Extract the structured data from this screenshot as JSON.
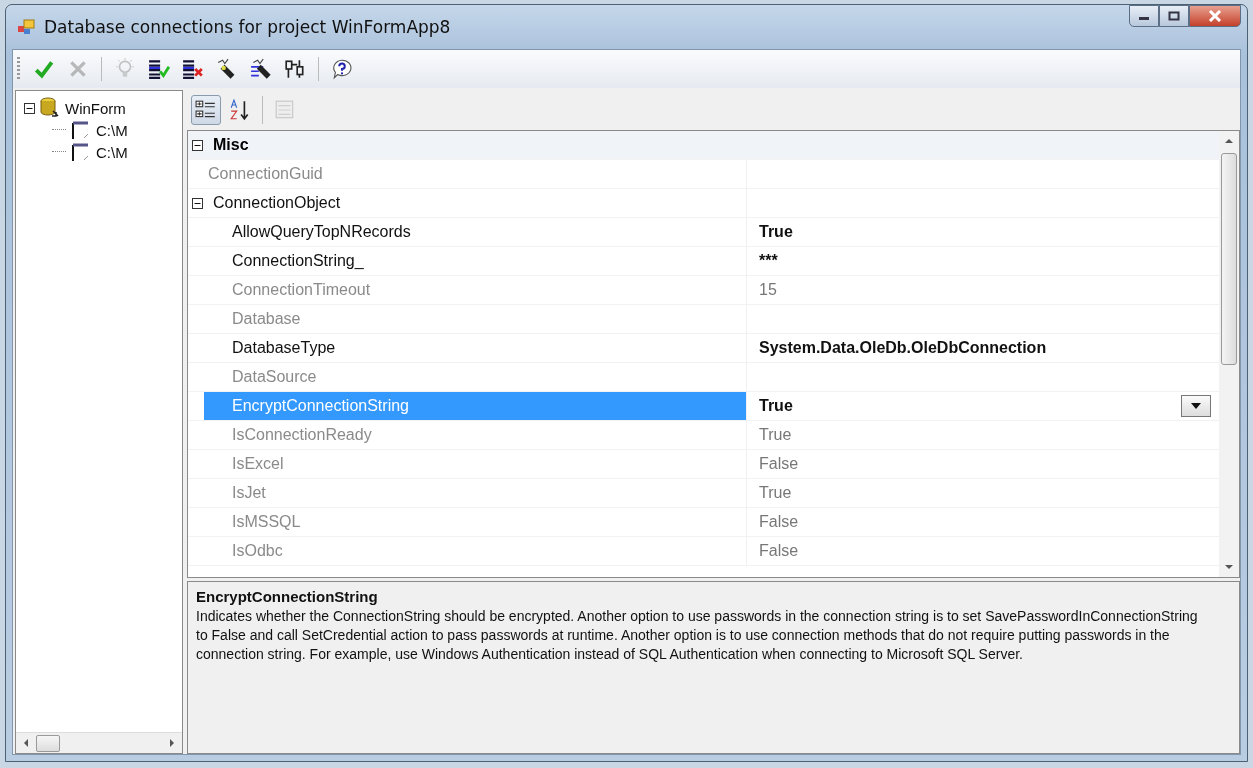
{
  "window": {
    "title": "Database connections for project WinFormApp8"
  },
  "toolbar": [
    {
      "kind": "check",
      "disabled": false
    },
    {
      "kind": "cross",
      "disabled": true
    },
    {
      "kind": "separator"
    },
    {
      "kind": "bulb",
      "disabled": true
    },
    {
      "kind": "list-check",
      "disabled": false
    },
    {
      "kind": "list-cross",
      "disabled": false
    },
    {
      "kind": "plug",
      "disabled": false
    },
    {
      "kind": "list-plug",
      "disabled": false
    },
    {
      "kind": "network",
      "disabled": false
    },
    {
      "kind": "separator"
    },
    {
      "kind": "help",
      "disabled": false
    }
  ],
  "tree": [
    {
      "label": "WinForm",
      "kind": "database",
      "expanded": true,
      "children": [
        {
          "label": "C:\\M",
          "kind": "connection"
        },
        {
          "label": "C:\\M",
          "kind": "connection"
        }
      ]
    }
  ],
  "grid_toolbar": [
    {
      "kind": "categorized",
      "selected": true,
      "disabled": false
    },
    {
      "kind": "alphabetical",
      "selected": false,
      "disabled": false
    },
    {
      "kind": "separator"
    },
    {
      "kind": "property-pages",
      "selected": false,
      "disabled": true
    }
  ],
  "grid": [
    {
      "kind": "category",
      "name": "Misc",
      "expanded": true,
      "children": [
        {
          "kind": "property",
          "name": "ConnectionGuid",
          "readonly": true,
          "selected": false
        },
        {
          "kind": "property",
          "name": "ConnectionObject",
          "readonly": false,
          "selected": false,
          "expanded": true,
          "children": [
            {
              "kind": "property",
              "name": "AllowQueryTopNRecords",
              "value": "True",
              "readonly": false,
              "modified": true,
              "selected": false
            },
            {
              "kind": "property",
              "name": "ConnectionString_",
              "value": "***",
              "readonly": false,
              "modified": true,
              "selected": false
            },
            {
              "kind": "property",
              "name": "ConnectionTimeout",
              "value": "15",
              "readonly": true,
              "modified": false,
              "selected": false
            },
            {
              "kind": "property",
              "name": "Database",
              "readonly": true,
              "selected": false
            },
            {
              "kind": "property",
              "name": "DatabaseType",
              "value": "System.Data.OleDb.OleDbConnection",
              "readonly": false,
              "modified": true,
              "selected": false
            },
            {
              "kind": "property",
              "name": "DataSource",
              "readonly": true,
              "selected": false
            },
            {
              "kind": "property",
              "name": "EncryptConnectionString",
              "value": "True",
              "readonly": false,
              "modified": true,
              "selected": true,
              "dropdown": true
            },
            {
              "kind": "property",
              "name": "IsConnectionReady",
              "value": "True",
              "readonly": true,
              "modified": false,
              "selected": false
            },
            {
              "kind": "property",
              "name": "IsExcel",
              "value": "False",
              "readonly": true,
              "modified": false,
              "selected": false
            },
            {
              "kind": "property",
              "name": "IsJet",
              "value": "True",
              "readonly": true,
              "modified": false,
              "selected": false
            },
            {
              "kind": "property",
              "name": "IsMSSQL",
              "value": "False",
              "readonly": true,
              "modified": false,
              "selected": false
            },
            {
              "kind": "property",
              "name": "IsOdbc",
              "value": "False",
              "readonly": true,
              "modified": false,
              "selected": false
            }
          ]
        }
      ]
    }
  ],
  "description": {
    "title": "EncryptConnectionString",
    "text": "Indicates whether the ConnectionString should be encrypted. Another option to use passwords in the connection string is to set SavePasswordInConnectionString to False and call SetCredential action to pass passwords at runtime. Another option is to use connection methods that do not require putting passwords in the connection string. For example, use Windows Authentication instead of SQL Authentication when connecting to Microsoft SQL Server."
  }
}
